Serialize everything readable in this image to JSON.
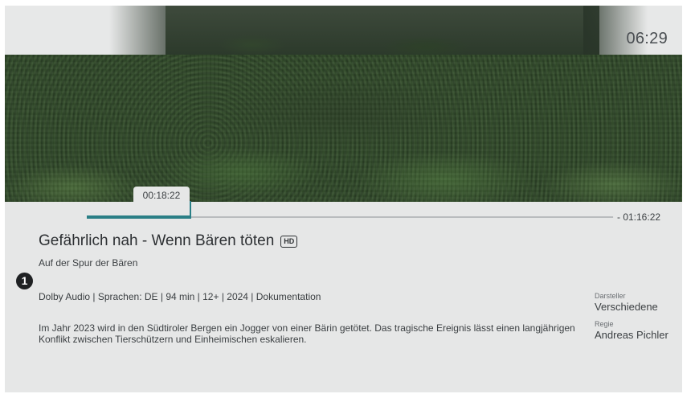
{
  "header": {
    "clock": "06:29"
  },
  "player": {
    "current_time": "00:18:22",
    "remaining_time": "- 01:16:22",
    "progress_fraction": 0.196,
    "accent_color": "#2a7f86"
  },
  "program": {
    "title": "Gefährlich nah - Wenn Bären töten",
    "quality_badge": "HD",
    "subtitle": "Auf der Spur der Bären",
    "marker_number": "1",
    "meta": "Dolby Audio | Sprachen: DE | 94 min | 12+ | 2024 | Dokumentation",
    "description": "Im Jahr 2023 wird in den Südtiroler Bergen ein Jogger von einer Bärin getötet. Das tragische Ereignis lässt einen langjährigen Konflikt zwischen Tierschützern und Einheimischen eskalieren."
  },
  "credits": {
    "cast_label": "Darsteller",
    "cast_value": "Verschiedene",
    "director_label": "Regie",
    "director_value": "Andreas Pichler"
  }
}
